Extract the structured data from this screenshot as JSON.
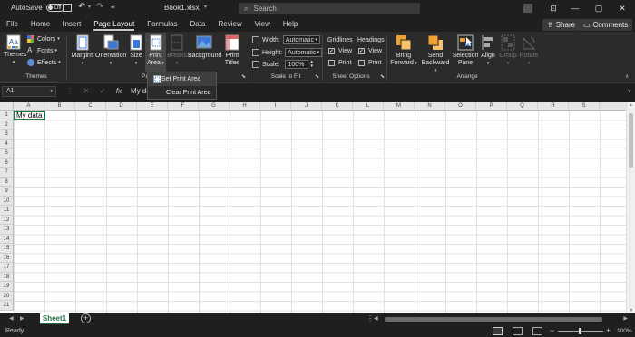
{
  "titlebar": {
    "autosave_label": "AutoSave",
    "autosave_state": "Off",
    "filename": "Book1.xlsx",
    "search_placeholder": "Search"
  },
  "tabs": [
    "File",
    "Home",
    "Insert",
    "Page Layout",
    "Formulas",
    "Data",
    "Review",
    "View",
    "Help"
  ],
  "active_tab": "Page Layout",
  "share_label": "Share",
  "comments_label": "Comments",
  "ribbon": {
    "themes": {
      "themes_label": "Themes",
      "colors": "Colors",
      "fonts": "Fonts",
      "effects": "Effects",
      "group": "Themes"
    },
    "page_setup": {
      "margins": "Margins",
      "orientation": "Orientation",
      "size": "Size",
      "print_area_1": "Print",
      "print_area_2": "Area",
      "breaks": "Breaks",
      "background": "Background",
      "print_titles_1": "Print",
      "print_titles_2": "Titles",
      "group": "Pa"
    },
    "scale_to_fit": {
      "width_label": "Width:",
      "width_value": "Automatic",
      "height_label": "Height:",
      "height_value": "Automatic",
      "scale_label": "Scale:",
      "scale_value": "100%",
      "group": "Scale to Fit"
    },
    "sheet_options": {
      "gridlines": "Gridlines",
      "headings": "Headings",
      "view": "View",
      "print": "Print",
      "group": "Sheet Options"
    },
    "arrange": {
      "bring_forward_1": "Bring",
      "bring_forward_2": "Forward",
      "send_backward_1": "Send",
      "send_backward_2": "Backward",
      "selection_pane_1": "Selection",
      "selection_pane_2": "Pane",
      "align": "Align",
      "group_btn": "Group",
      "rotate": "Rotate",
      "group": "Arrange"
    }
  },
  "dropdown": {
    "set_print_area": "Set Print Area",
    "clear_print_area": "Clear Print Area"
  },
  "formula_bar": {
    "name_box": "A1",
    "fx": "fx",
    "content": "My da"
  },
  "columns": [
    "A",
    "B",
    "C",
    "D",
    "E",
    "F",
    "G",
    "H",
    "I",
    "J",
    "K",
    "L",
    "M",
    "N",
    "O",
    "P",
    "Q",
    "R",
    "S"
  ],
  "rows": [
    "1",
    "2",
    "3",
    "4",
    "5",
    "6",
    "7",
    "8",
    "9",
    "10",
    "11",
    "12",
    "13",
    "14",
    "15",
    "16",
    "17",
    "18",
    "19",
    "20",
    "21"
  ],
  "cell_a1": "My data",
  "sheet_tab": "Sheet1",
  "status": {
    "ready": "Ready",
    "zoom": "100%"
  },
  "colors": {
    "excel_green": "#217346",
    "ribbon_bg": "#2b2b2b",
    "accent_orange": "#f0a030"
  }
}
